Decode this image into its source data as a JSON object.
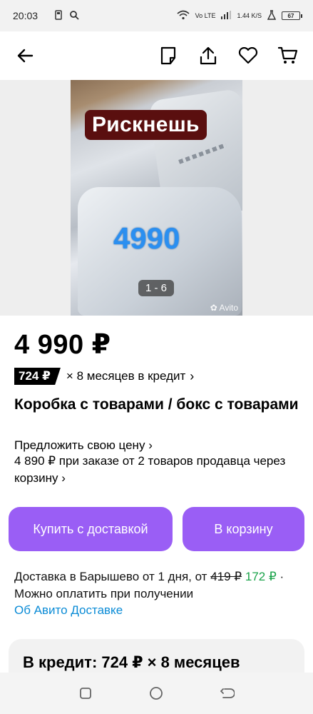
{
  "status_bar": {
    "time": "20:03",
    "network": "Vo LTE",
    "speed": "1.44 K/S",
    "battery": "67"
  },
  "toolbar": {
    "back_icon": "arrow-left-icon",
    "note_icon": "note-icon",
    "share_icon": "share-icon",
    "favorite_icon": "heart-icon",
    "cart_icon": "cart-icon"
  },
  "gallery": {
    "overlay_label": "Рискнешь",
    "overlay_price": "4990",
    "counter": "1 - 6",
    "watermark": "Avito"
  },
  "listing": {
    "price": "4 990 ₽",
    "credit_badge": "724 ₽",
    "credit_text": "× 8 месяцев в кредит",
    "title": "Коробка с товарами / бокс с товарами",
    "offer_price": "Предложить свою цену",
    "condition": "4 890 ₽ при заказе от 2 товаров продавца через корзину"
  },
  "actions": {
    "buy_label": "Купить с доставкой",
    "cart_label": "В корзину",
    "accent_color": "#9a5ef5"
  },
  "delivery": {
    "text": "Доставка в Барышево от 1 дня, от",
    "old_price": "419 ₽",
    "new_price": "172 ₽",
    "payment": "Можно оплатить при получении",
    "link": "Об Авито Доставке"
  },
  "credit_card": {
    "title": "В кредит: 724 ₽ × 8 месяцев"
  }
}
